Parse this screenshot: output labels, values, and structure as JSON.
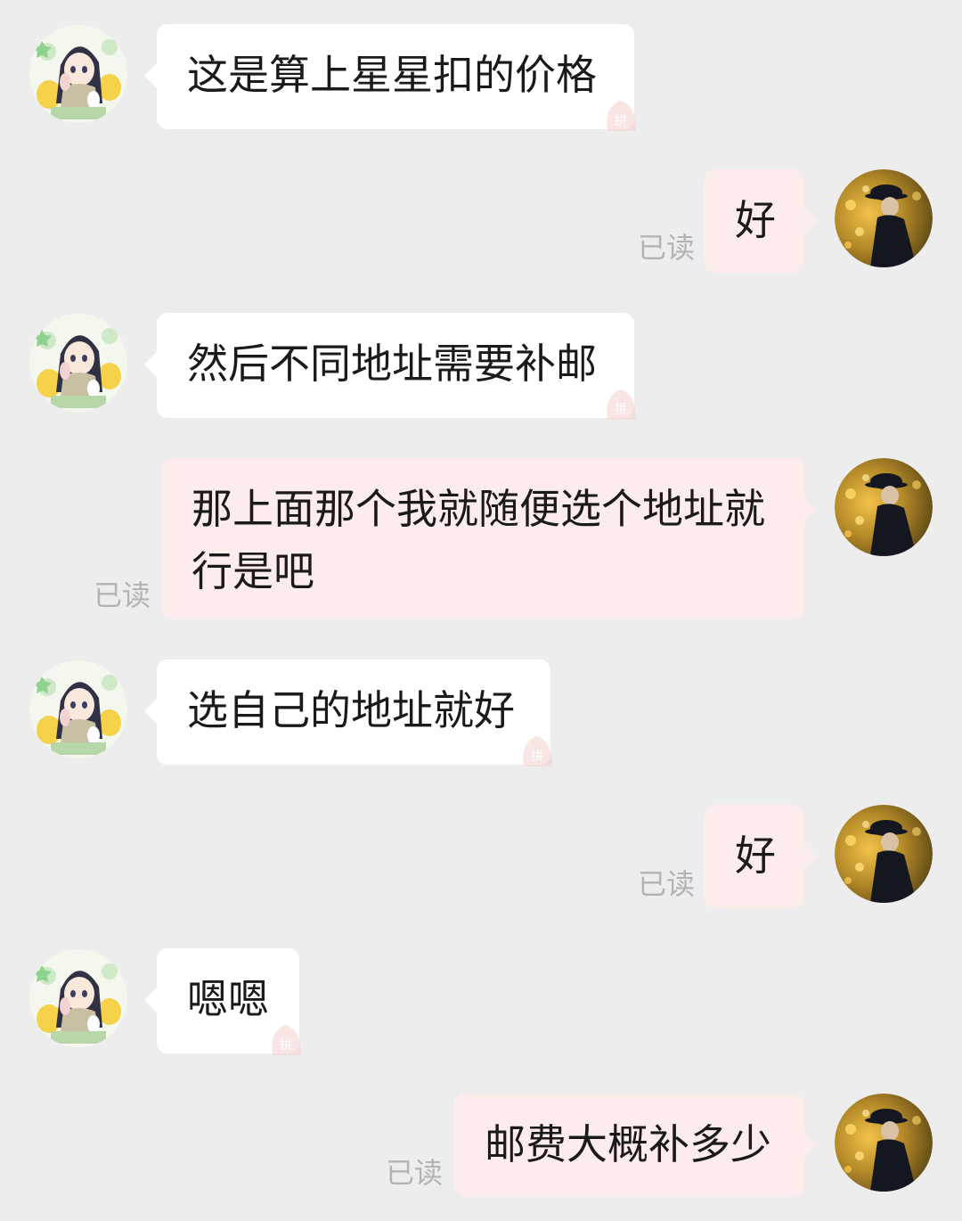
{
  "read_label": "已读",
  "messages": [
    {
      "side": "left",
      "text": "这是算上星星扣的价格"
    },
    {
      "side": "right",
      "text": "好"
    },
    {
      "side": "left",
      "text": "然后不同地址需要补邮"
    },
    {
      "side": "right",
      "text": "那上面那个我就随便选个地址就行是吧"
    },
    {
      "side": "left",
      "text": "选自己的地址就好"
    },
    {
      "side": "right",
      "text": "好"
    },
    {
      "side": "left",
      "text": "嗯嗯"
    },
    {
      "side": "right",
      "text": "邮费大概补多少"
    }
  ],
  "icons": {
    "contact_avatar": "anime-girl-avatar",
    "self_avatar": "person-in-hat-avatar",
    "badge": "pin-badge-icon"
  },
  "colors": {
    "background": "#ededed",
    "incoming_bubble": "#ffffff",
    "outgoing_bubble": "#fdecec",
    "read_text": "#b3b3b3"
  }
}
